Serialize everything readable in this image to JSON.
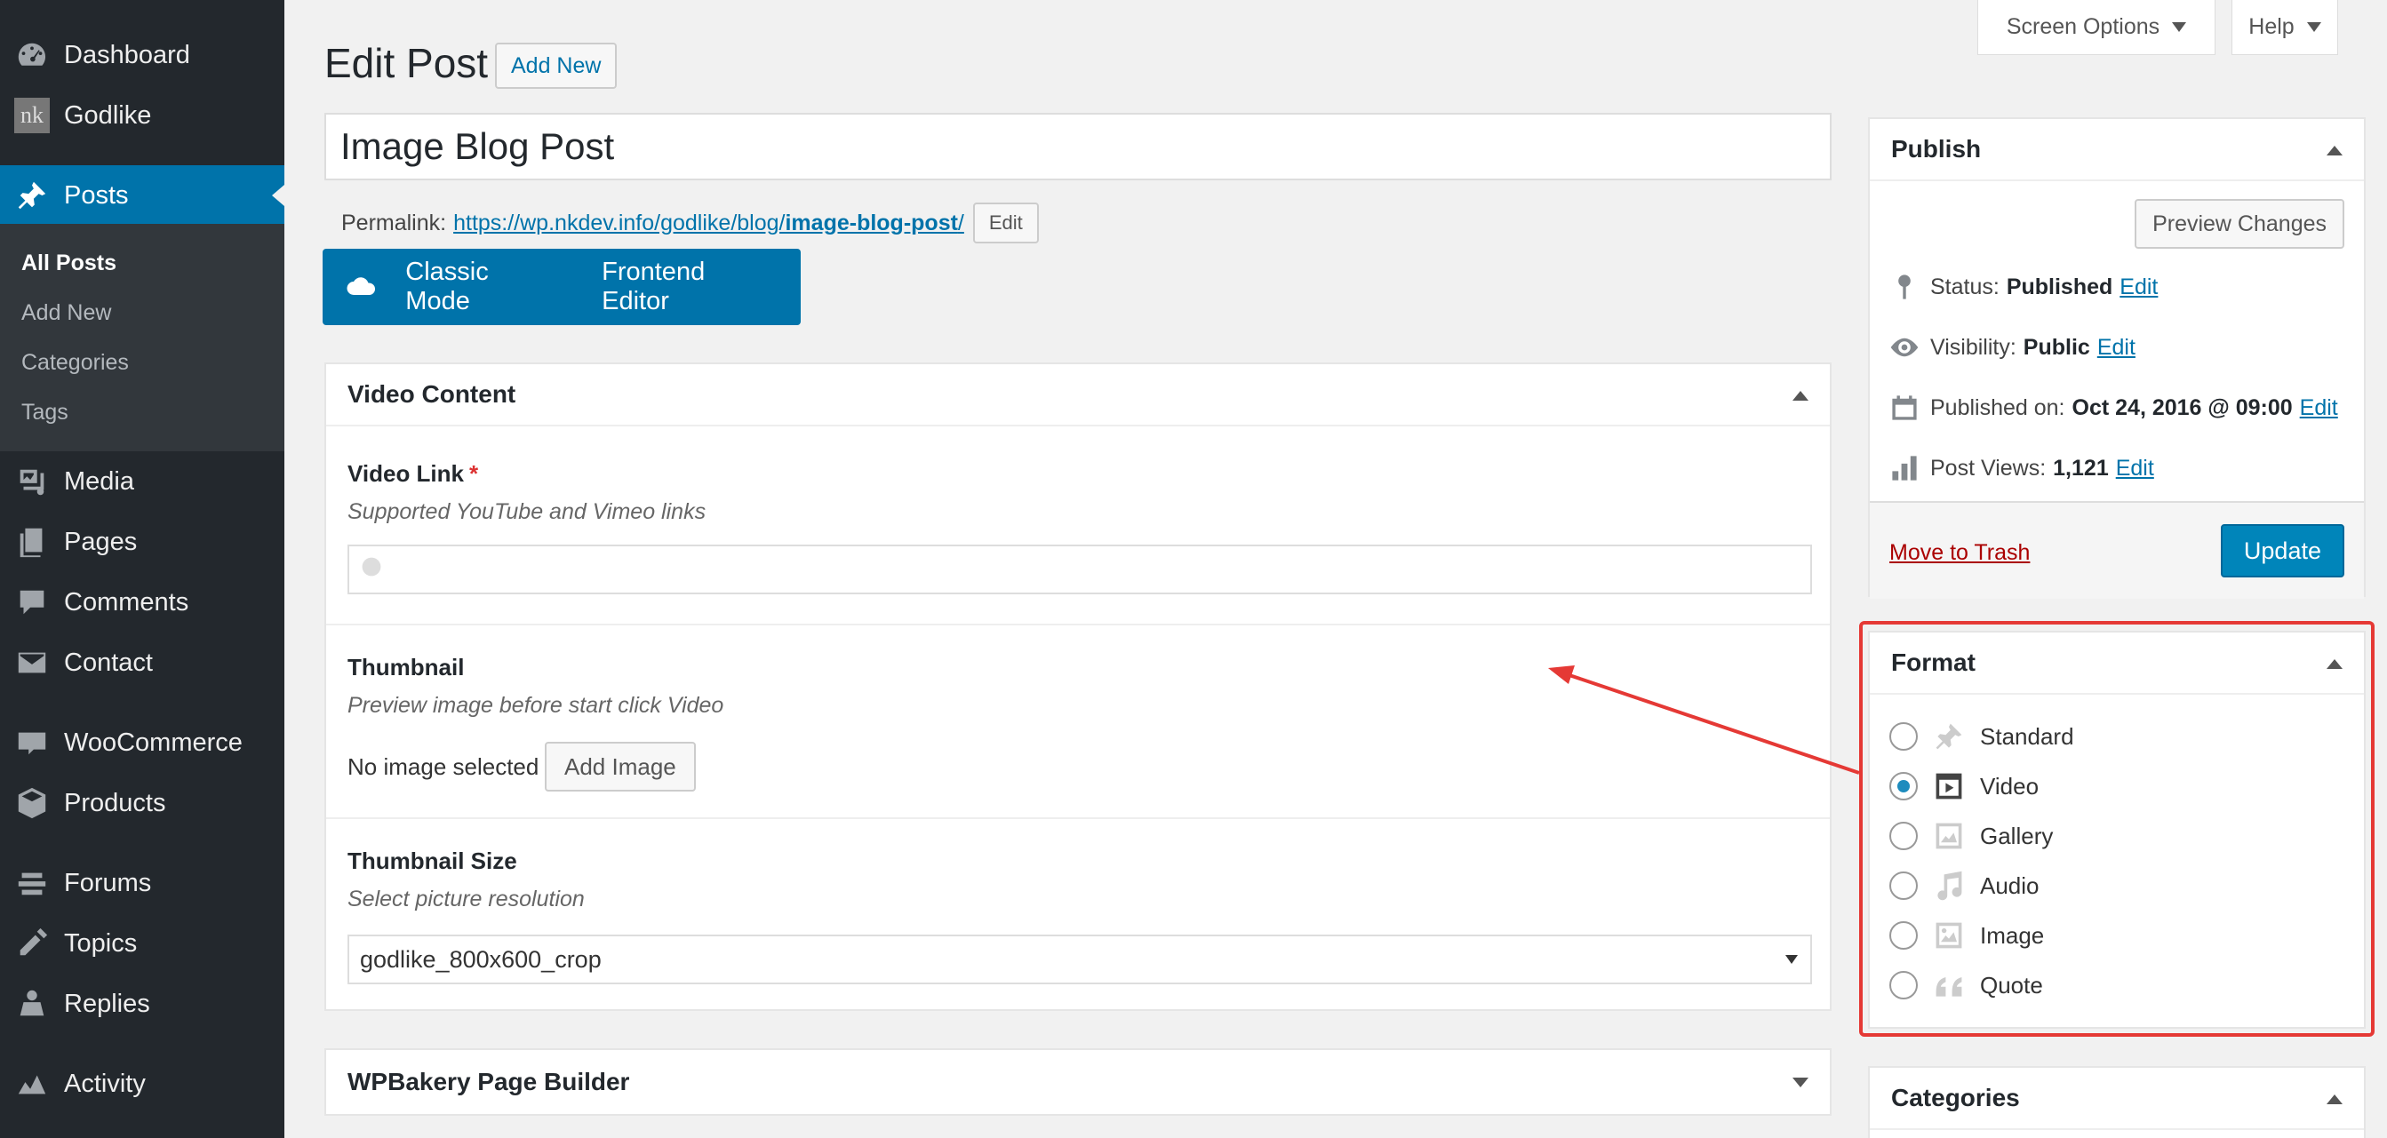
{
  "sidebar": {
    "items": [
      {
        "label": "Dashboard",
        "icon": "dashboard-icon"
      },
      {
        "label": "Godlike",
        "icon": "godlike-logo-icon"
      },
      {
        "label": "Posts",
        "icon": "pin-icon",
        "active": true
      },
      {
        "label": "Media",
        "icon": "media-icon"
      },
      {
        "label": "Pages",
        "icon": "pages-icon"
      },
      {
        "label": "Comments",
        "icon": "comments-icon"
      },
      {
        "label": "Contact",
        "icon": "mail-icon"
      },
      {
        "label": "WooCommerce",
        "icon": "woocommerce-icon"
      },
      {
        "label": "Products",
        "icon": "products-icon"
      },
      {
        "label": "Forums",
        "icon": "forums-icon"
      },
      {
        "label": "Topics",
        "icon": "topics-icon"
      },
      {
        "label": "Replies",
        "icon": "replies-icon"
      },
      {
        "label": "Activity",
        "icon": "activity-icon"
      }
    ],
    "godlike_logo_text": "nk",
    "submenu": [
      "All Posts",
      "Add New",
      "Categories",
      "Tags"
    ]
  },
  "top_tabs": {
    "screen_options": "Screen Options",
    "help": "Help"
  },
  "header": {
    "title": "Edit Post",
    "add_new": "Add New"
  },
  "post": {
    "title": "Image Blog Post",
    "permalink_label": "Permalink:",
    "permalink_base": "https://wp.nkdev.info/godlike/blog/",
    "permalink_slug": "image-blog-post",
    "permalink_tail": "/",
    "permalink_edit": "Edit"
  },
  "builder_bar": {
    "classic_mode": "Classic Mode",
    "frontend_editor": "Frontend Editor"
  },
  "video_content": {
    "title": "Video Content",
    "video_link_label": "Video Link",
    "required_mark": "*",
    "video_link_desc": "Supported YouTube and Vimeo links",
    "video_link_value": "",
    "thumbnail_label": "Thumbnail",
    "thumbnail_desc": "Preview image before start click Video",
    "no_image": "No image selected",
    "add_image": "Add Image",
    "thumb_size_label": "Thumbnail Size",
    "thumb_size_desc": "Select picture resolution",
    "thumb_size_value": "godlike_800x600_crop"
  },
  "wpbakery": {
    "title": "WPBakery Page Builder"
  },
  "publish": {
    "title": "Publish",
    "preview_changes": "Preview Changes",
    "status_label": "Status:",
    "status_value": "Published",
    "visibility_label": "Visibility:",
    "visibility_value": "Public",
    "published_label": "Published on:",
    "published_value": "Oct 24, 2016 @ 09:00",
    "views_label": "Post Views:",
    "views_value": "1,121",
    "edit": "Edit",
    "move_to_trash": "Move to Trash",
    "update": "Update"
  },
  "format": {
    "title": "Format",
    "options": [
      {
        "label": "Standard",
        "icon": "pin-icon",
        "checked": false
      },
      {
        "label": "Video",
        "icon": "video-icon",
        "checked": true
      },
      {
        "label": "Gallery",
        "icon": "gallery-icon",
        "checked": false
      },
      {
        "label": "Audio",
        "icon": "audio-icon",
        "checked": false
      },
      {
        "label": "Image",
        "icon": "image-icon",
        "checked": false
      },
      {
        "label": "Quote",
        "icon": "quote-icon",
        "checked": false
      }
    ]
  },
  "categories": {
    "title": "Categories"
  },
  "colors": {
    "accent": "#0073aa",
    "sidebar": "#23282d",
    "highlight": "#e53935"
  }
}
